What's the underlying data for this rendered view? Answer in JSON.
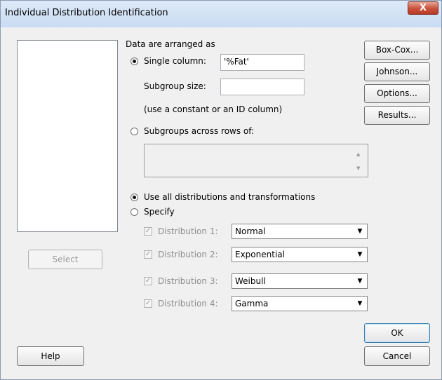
{
  "window": {
    "title": "Individual Distribution Identification",
    "close_label": "X"
  },
  "left": {
    "select_label": "Select",
    "help_label": "Help"
  },
  "data": {
    "arranged_label": "Data are arranged as",
    "single_column_label": "Single column:",
    "single_column_value": "'%Fat'",
    "subgroup_size_label": "Subgroup size:",
    "subgroup_size_value": "",
    "hint": "(use a constant or an ID column)",
    "subgroups_rows_label": "Subgroups across rows of:",
    "subgroups_rows_value": ""
  },
  "distributions": {
    "use_all_label": "Use all distributions and transformations",
    "specify_label": "Specify",
    "mode_selected": "use_all",
    "items": [
      {
        "label": "Distribution 1:",
        "value": "Normal",
        "checked": true
      },
      {
        "label": "Distribution 2:",
        "value": "Exponential",
        "checked": true
      },
      {
        "label": "Distribution 3:",
        "value": "Weibull",
        "checked": true
      },
      {
        "label": "Distribution 4:",
        "value": "Gamma",
        "checked": true
      }
    ]
  },
  "right_buttons": {
    "boxcox": "Box-Cox...",
    "johnson": "Johnson...",
    "options": "Options...",
    "results": "Results...",
    "ok": "OK",
    "cancel": "Cancel"
  }
}
